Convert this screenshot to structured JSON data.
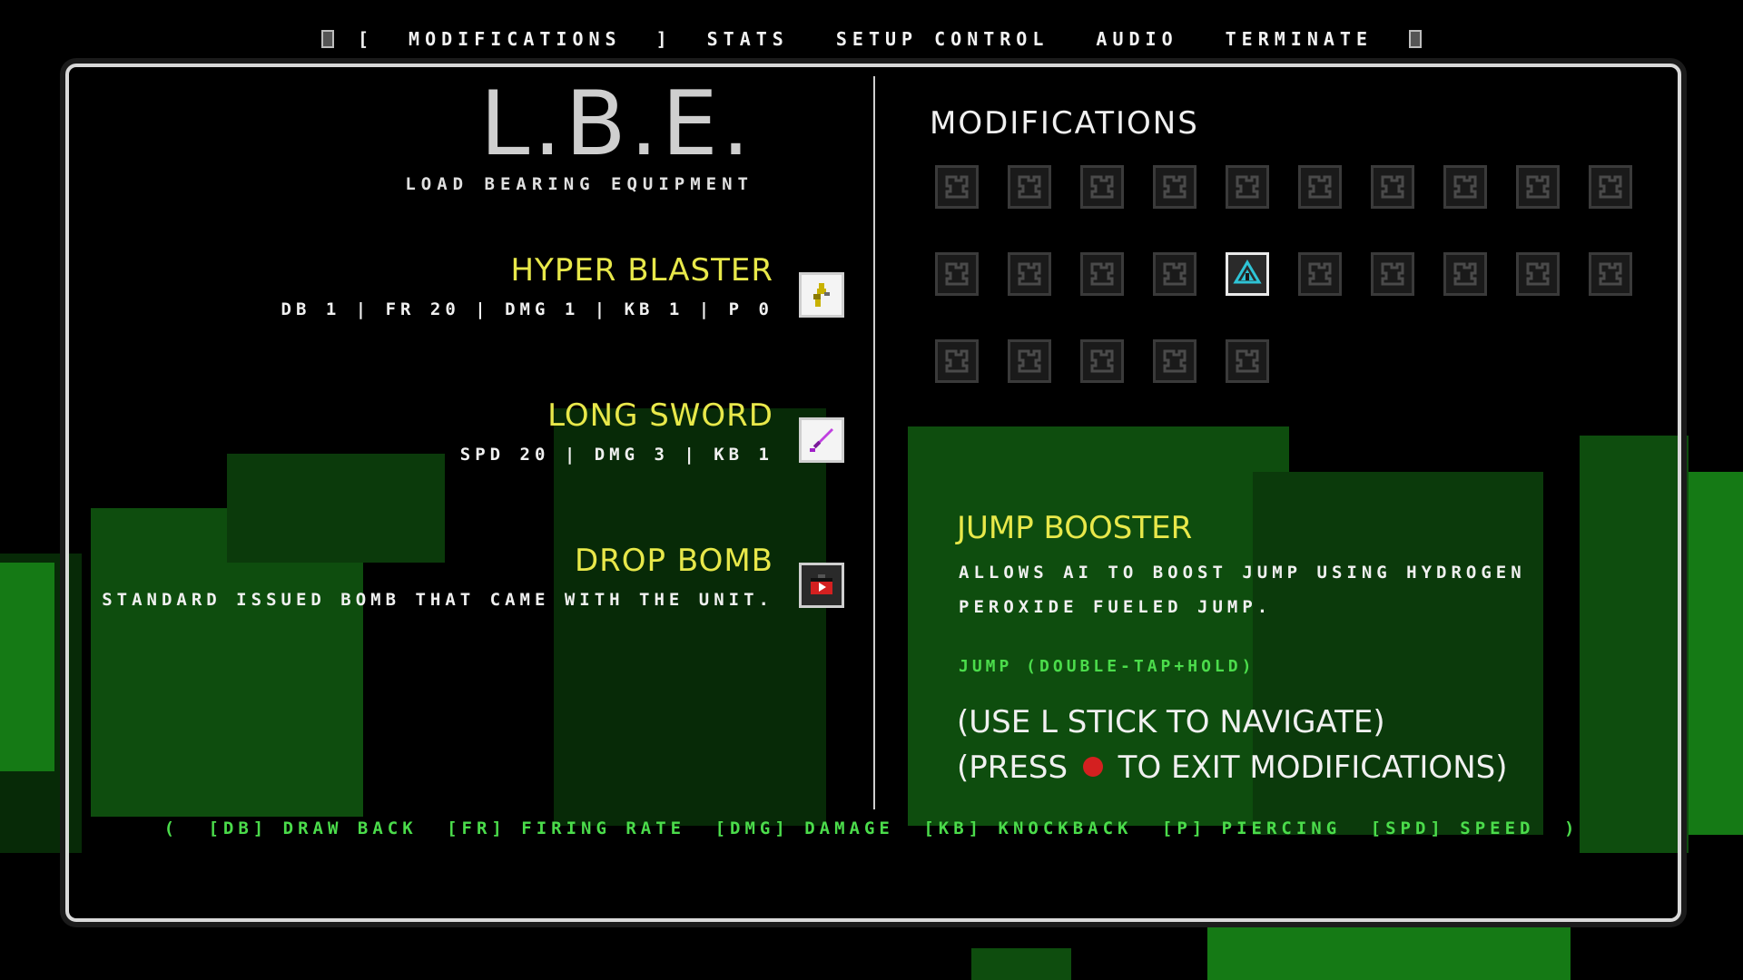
{
  "top_menu": {
    "left_bracket": "[",
    "right_bracket": "]",
    "items": [
      "MODIFICATIONS",
      "STATS",
      "SETUP CONTROL",
      "AUDIO",
      "TERMINATE"
    ]
  },
  "loadout": {
    "title": "L.B.E.",
    "subtitle": "LOAD BEARING EQUIPMENT",
    "weapons": [
      {
        "name": "HYPER BLASTER",
        "stats": "DB 1 | FR 20 | DMG 1 | KB 1 | P 0",
        "icon": "blaster-icon",
        "color": "#c9b200"
      },
      {
        "name": "LONG SWORD",
        "stats": "SPD 20 | DMG 3 | KB 1",
        "icon": "sword-icon",
        "color": "#a020c8"
      },
      {
        "name": "DROP BOMB",
        "stats": "STANDARD ISSUED BOMB THAT CAME WITH THE UNIT.",
        "icon": "bomb-icon",
        "color": "#d42020"
      }
    ]
  },
  "modifications": {
    "title": "MODIFICATIONS",
    "selected_index": 14,
    "slot_count": 25,
    "selected": {
      "name": "JUMP BOOSTER",
      "description": "ALLOWS AI TO BOOST JUMP USING HYDROGEN PEROXIDE FUELED JUMP.",
      "control": "JUMP (DOUBLE-TAP+HOLD)"
    }
  },
  "hints": {
    "navigate": "(USE L STICK TO NAVIGATE)",
    "exit_prefix": "(PRESS",
    "exit_suffix": "TO EXIT MODIFICATIONS)"
  },
  "legend": {
    "open": "(",
    "close": ")",
    "items": [
      "[DB] DRAW BACK",
      "[FR] FIRING RATE",
      "[DMG] DAMAGE",
      "[KB] KNOCKBACK",
      "[P] PIERCING",
      "[SPD] SPEED"
    ]
  },
  "colors": {
    "accent_yellow": "#e8e84a",
    "accent_green": "#4bdc4b",
    "selected_mod": "#2ec4d6"
  }
}
